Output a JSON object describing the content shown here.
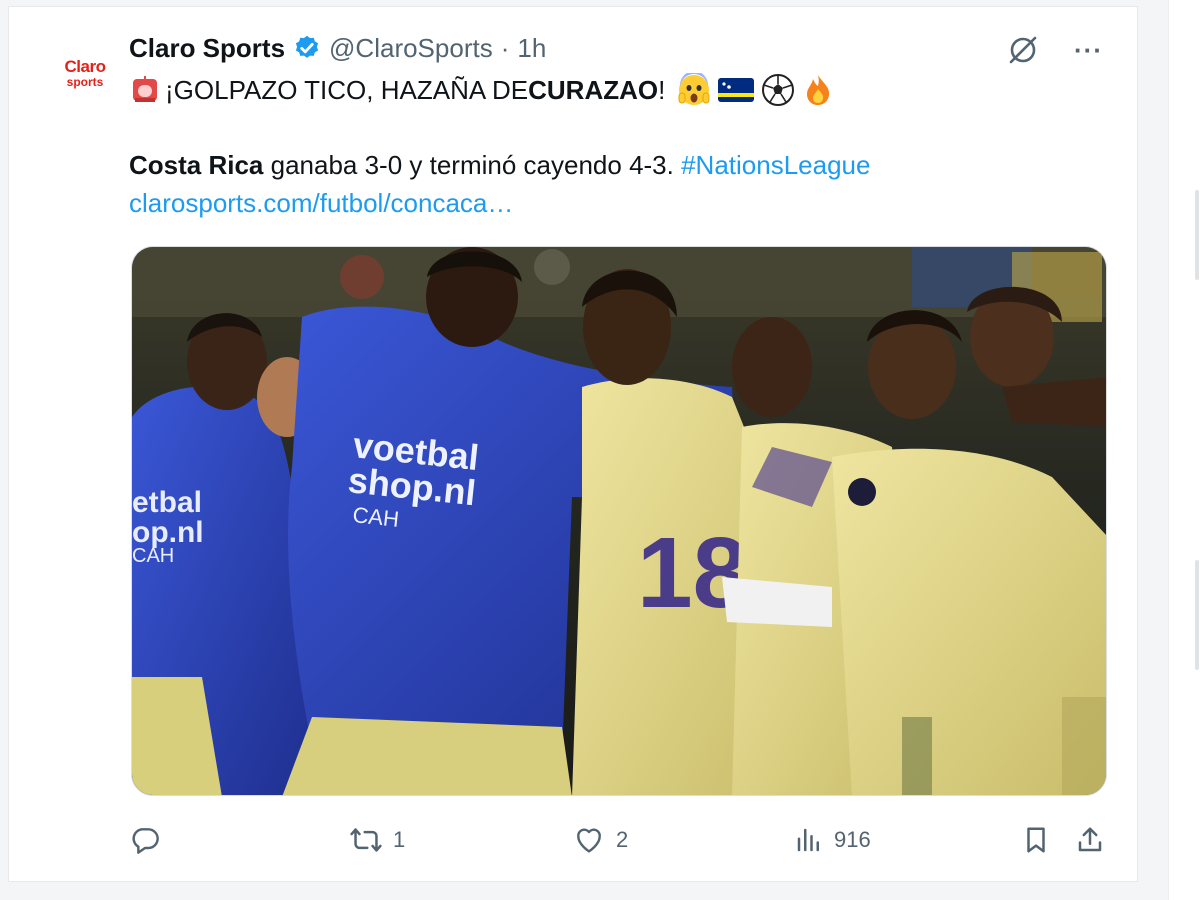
{
  "account": {
    "avatar_line1": "Claro",
    "avatar_line2": "sports",
    "display_name": "Claro Sports",
    "handle": "@ClaroSports",
    "separator": "·",
    "time": "1h"
  },
  "tweet": {
    "headline_prefix": "¡GOLPAZO TICO, HAZAÑA DE ",
    "headline_bold": "CURAZAO",
    "headline_suffix": "!",
    "line2_bold": "Costa Rica",
    "line2_text": " ganaba 3-0 y terminó cayendo 4-3. ",
    "hashtag": "#NationsLeague",
    "link": "clarosports.com/futbol/concaca…"
  },
  "media": {
    "jersey_text_1": "voetbal",
    "jersey_text_2": "shop.nl",
    "jersey_text_3": "CAH",
    "jersey_left_1": "etbal",
    "jersey_left_2": "op.nl",
    "jersey_left_3": "CAH",
    "shirt_number": "18"
  },
  "actions": {
    "replies": "",
    "reposts": "1",
    "likes": "2",
    "views": "916"
  },
  "icons": {
    "verified": "verified-badge-icon",
    "grok": "grok-icon",
    "more": "more-icon",
    "reply": "reply-icon",
    "repost": "repost-icon",
    "like": "heart-icon",
    "views": "views-icon",
    "bookmark": "bookmark-icon",
    "share": "share-icon"
  },
  "colors": {
    "brand_red": "#e2231a",
    "link_blue": "#1d9bf0",
    "muted": "#536471",
    "jersey_yellow": "#e6dc8c",
    "hoodie_blue": "#2d44b8"
  }
}
